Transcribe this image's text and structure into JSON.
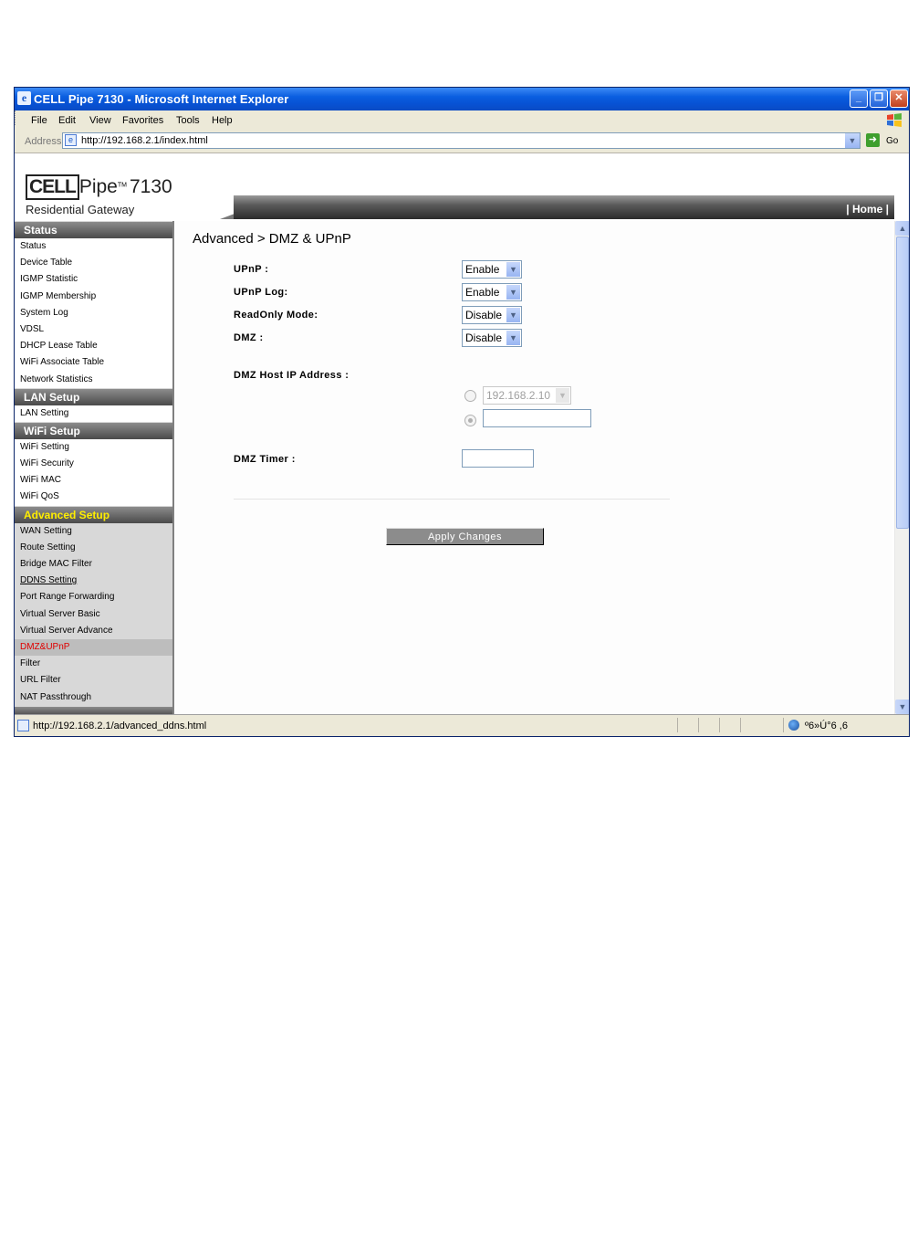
{
  "window": {
    "title": "CELL Pipe 7130 - Microsoft Internet Explorer",
    "ie_icon": "ie-icon",
    "controls": {
      "minimize": "_",
      "maximize": "❐",
      "close": "✕"
    }
  },
  "menu": {
    "items": [
      "File",
      "Edit",
      "View",
      "Favorites",
      "Tools",
      "Help"
    ]
  },
  "address_bar": {
    "label": "Address",
    "url": "http://192.168.2.1/index.html",
    "go_label": "Go"
  },
  "header": {
    "logo_cell": "CELL",
    "logo_pipe": "Pipe",
    "logo_tm": "TM",
    "logo_model": "7130",
    "logo_subtitle": "Residential Gateway",
    "home_link": "| Home |"
  },
  "sidebar": {
    "sections": [
      {
        "title": "Status",
        "items": [
          "Status",
          "Device Table",
          "IGMP Statistic",
          "IGMP Membership",
          "System Log",
          "VDSL",
          "DHCP Lease Table",
          "WiFi Associate Table",
          "Network Statistics"
        ]
      },
      {
        "title": "LAN Setup",
        "items": [
          "LAN Setting"
        ]
      },
      {
        "title": "WiFi Setup",
        "items": [
          "WiFi Setting",
          "WiFi Security",
          "WiFi MAC",
          "WiFi QoS"
        ]
      },
      {
        "title": "Advanced Setup",
        "items": [
          "WAN Setting",
          "Route Setting",
          "Bridge MAC Filter",
          "DDNS Setting",
          "Port Range Forwarding",
          "Virtual Server Basic",
          "Virtual Server Advance",
          "DMZ&UPnP",
          "Filter",
          "URL Filter",
          "NAT Passthrough"
        ]
      }
    ]
  },
  "content": {
    "page_title": "Advanced > DMZ & UPnP",
    "fields": {
      "upnp_label": "UPnP :",
      "upnp_value": "Enable",
      "upnp_log_label": "UPnP Log:",
      "upnp_log_value": "Enable",
      "readonly_label": "ReadOnly Mode:",
      "readonly_value": "Disable",
      "dmz_label": "DMZ :",
      "dmz_value": "Disable",
      "dmz_host_label": "DMZ Host IP Address :",
      "dmz_host_select_value": "192.168.2.10",
      "dmz_host_input_value": "",
      "dmz_timer_label": "DMZ Timer :",
      "dmz_timer_value": ""
    },
    "apply_button": "Apply Changes"
  },
  "statusbar": {
    "text": "http://192.168.2.1/advanced_ddns.html",
    "zone": "º6»Ú°6 ,6"
  },
  "colors": {
    "titlebar": "#0a5ee0",
    "section_header": "#4a4a4a",
    "advanced_header_text": "#ffee00",
    "active_item_text": "#e00000"
  }
}
